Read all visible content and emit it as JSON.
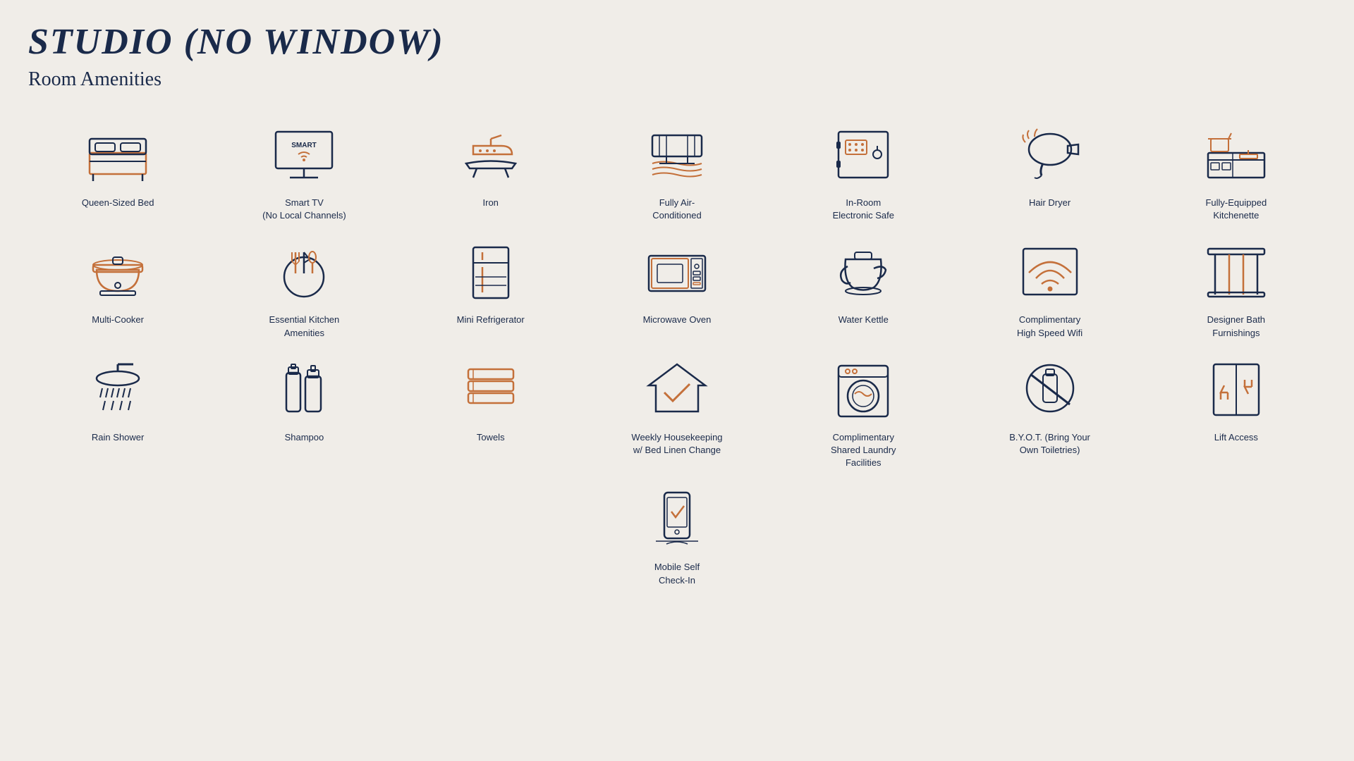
{
  "title": "STUDIO (NO WINDOW)",
  "subtitle": "Room Amenities",
  "amenities": [
    {
      "id": "queen-bed",
      "label": "Queen-Sized Bed"
    },
    {
      "id": "smart-tv",
      "label": "Smart TV\n(No Local Channels)"
    },
    {
      "id": "iron",
      "label": "Iron"
    },
    {
      "id": "air-conditioned",
      "label": "Fully Air-\nConditioned"
    },
    {
      "id": "safe",
      "label": "In-Room\nElectronic Safe"
    },
    {
      "id": "hair-dryer",
      "label": "Hair Dryer"
    },
    {
      "id": "kitchenette",
      "label": "Fully-Equipped\nKitchenette"
    },
    {
      "id": "multi-cooker",
      "label": "Multi-Cooker"
    },
    {
      "id": "kitchen-amenities",
      "label": "Essential Kitchen\nAmenities"
    },
    {
      "id": "mini-fridge",
      "label": "Mini Refrigerator"
    },
    {
      "id": "microwave",
      "label": "Microwave Oven"
    },
    {
      "id": "water-kettle",
      "label": "Water Kettle"
    },
    {
      "id": "wifi",
      "label": "Complimentary\nHigh Speed Wifi"
    },
    {
      "id": "bath-furnishings",
      "label": "Designer Bath\nFurnishings"
    },
    {
      "id": "rain-shower",
      "label": "Rain Shower"
    },
    {
      "id": "shampoo",
      "label": "Shampoo"
    },
    {
      "id": "towels",
      "label": "Towels"
    },
    {
      "id": "housekeeping",
      "label": "Weekly Housekeeping\nw/ Bed Linen Change"
    },
    {
      "id": "laundry",
      "label": "Complimentary\nShared Laundry\nFacilities"
    },
    {
      "id": "byot",
      "label": "B.Y.O.T. (Bring Your\nOwn Toiletries)"
    },
    {
      "id": "lift",
      "label": "Lift Access"
    },
    {
      "id": "mobile-checkin",
      "label": "Mobile Self\nCheck-In"
    }
  ]
}
